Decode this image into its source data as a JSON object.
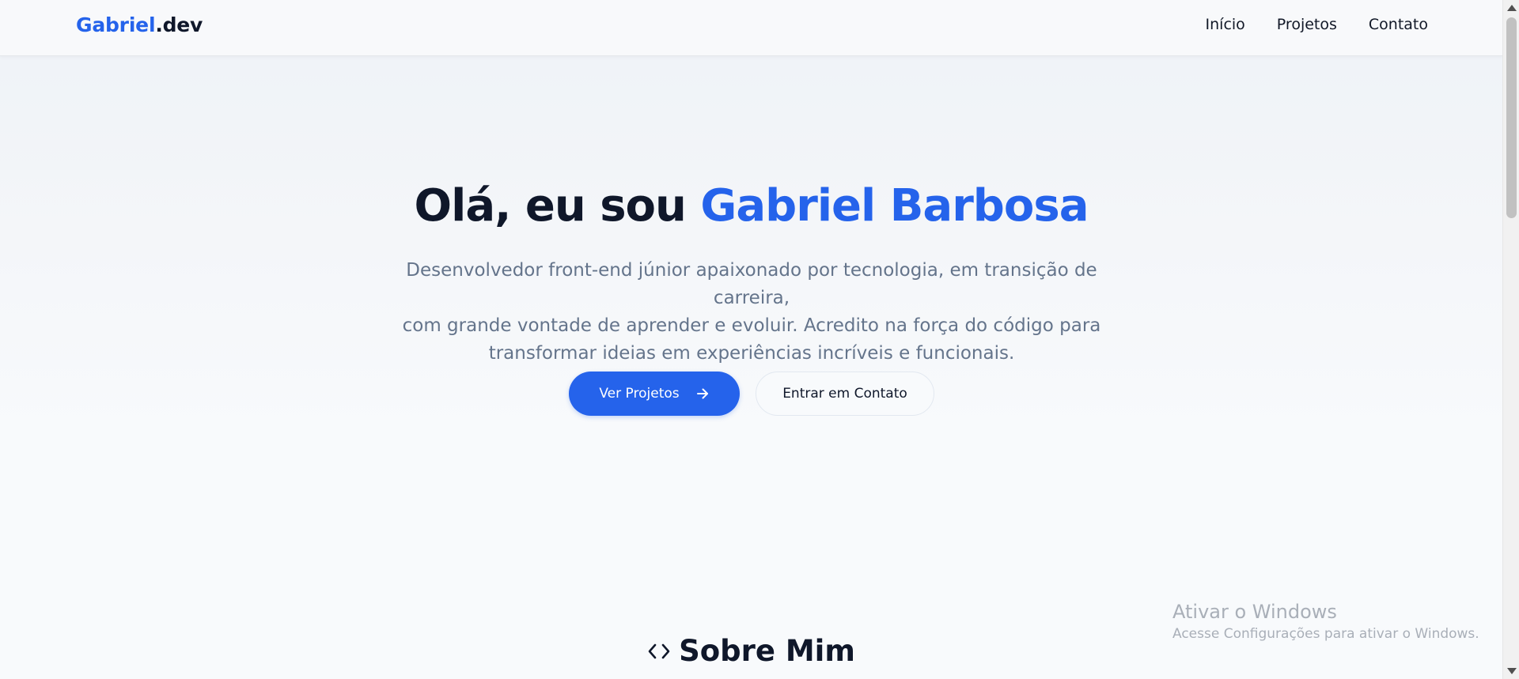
{
  "navbar": {
    "logo_accent": "Gabriel",
    "logo_rest": ".dev",
    "links": [
      "Início",
      "Projetos",
      "Contato"
    ]
  },
  "hero": {
    "title_prefix": "Olá, eu sou ",
    "title_name": "Gabriel Barbosa",
    "description_lines": [
      "Desenvolvedor front-end júnior apaixonado por tecnologia, em transição de carreira,",
      "com grande vontade de aprender e evoluir. Acredito na força do código para",
      "transformar ideias em experiências incríveis e funcionais."
    ],
    "primary_button": "Ver Projetos",
    "secondary_button": "Entrar em Contato"
  },
  "about": {
    "title": "Sobre Mim",
    "icon": "code-icon"
  },
  "watermark": {
    "title": "Ativar o Windows",
    "subtitle": "Acesse Configurações para ativar o Windows."
  },
  "colors": {
    "accent": "#2563eb",
    "text": "#0f172a",
    "muted": "#64748b"
  }
}
